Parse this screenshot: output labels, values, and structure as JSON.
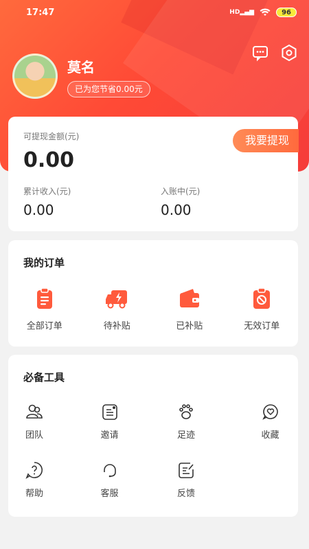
{
  "status_bar": {
    "time": "17:47",
    "signal_text": "HD",
    "battery": "96"
  },
  "header_icons": [
    "message-icon",
    "settings-hex-icon"
  ],
  "user": {
    "name": "莫名",
    "saved_text": "已为您节省0.00元"
  },
  "wallet": {
    "withdrawable_label": "可提现金额(元)",
    "withdrawable_value": "0.00",
    "withdraw_button": "我要提现",
    "cumulative_label": "累计收入(元)",
    "cumulative_value": "0.00",
    "pending_label": "入账中(元)",
    "pending_value": "0.00"
  },
  "orders": {
    "title": "我的订单",
    "items": [
      {
        "label": "全部订单",
        "icon": "clipboard-icon"
      },
      {
        "label": "待补贴",
        "icon": "truck-bolt-icon"
      },
      {
        "label": "已补贴",
        "icon": "wallet-icon"
      },
      {
        "label": "无效订单",
        "icon": "invalid-order-icon"
      }
    ]
  },
  "tools": {
    "title": "必备工具",
    "items": [
      {
        "label": "团队",
        "icon": "team-icon"
      },
      {
        "label": "邀请",
        "icon": "invite-icon"
      },
      {
        "label": "足迹",
        "icon": "footprint-icon"
      },
      {
        "label": "收藏",
        "icon": "favorite-icon"
      },
      {
        "label": "帮助",
        "icon": "help-icon"
      },
      {
        "label": "客服",
        "icon": "customer-service-icon"
      },
      {
        "label": "反馈",
        "icon": "feedback-icon"
      }
    ]
  },
  "colors": {
    "accent": "#ff5a3c",
    "hero_start": "#ff6a3d",
    "hero_end": "#f53c3a"
  }
}
